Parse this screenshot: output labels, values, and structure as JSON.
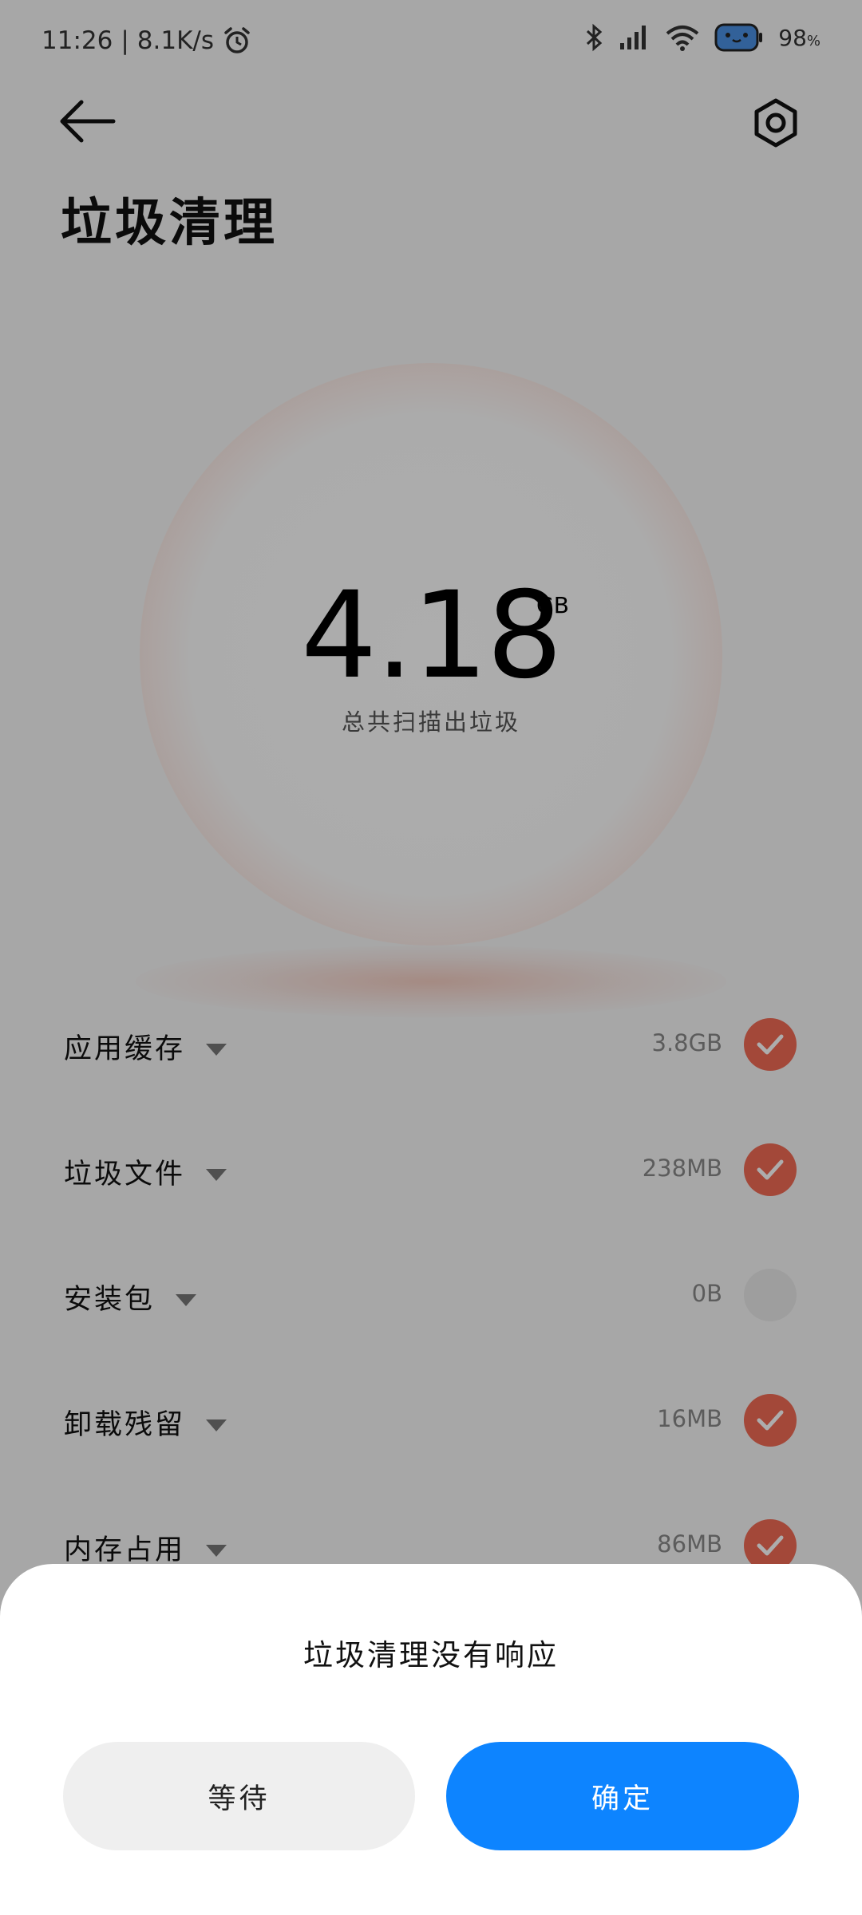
{
  "status_bar": {
    "time": "11:26",
    "network_speed": "8.1K/s",
    "battery": "98",
    "battery_unit": "%"
  },
  "header": {
    "title": "垃圾清理"
  },
  "summary": {
    "amount": "4.18",
    "unit": "GB",
    "caption": "总共扫描出垃圾"
  },
  "categories": [
    {
      "label": "应用缓存",
      "size": "3.8GB",
      "checked": true
    },
    {
      "label": "垃圾文件",
      "size": "238MB",
      "checked": true
    },
    {
      "label": "安装包",
      "size": "0B",
      "checked": false
    },
    {
      "label": "卸载残留",
      "size": "16MB",
      "checked": true
    },
    {
      "label": "内存占用",
      "size": "86MB",
      "checked": true
    }
  ],
  "dialog": {
    "title": "垃圾清理没有响应",
    "wait_label": "等待",
    "ok_label": "确定"
  },
  "colors": {
    "accent_check": "#f06a55",
    "primary_button": "#0d84ff"
  }
}
